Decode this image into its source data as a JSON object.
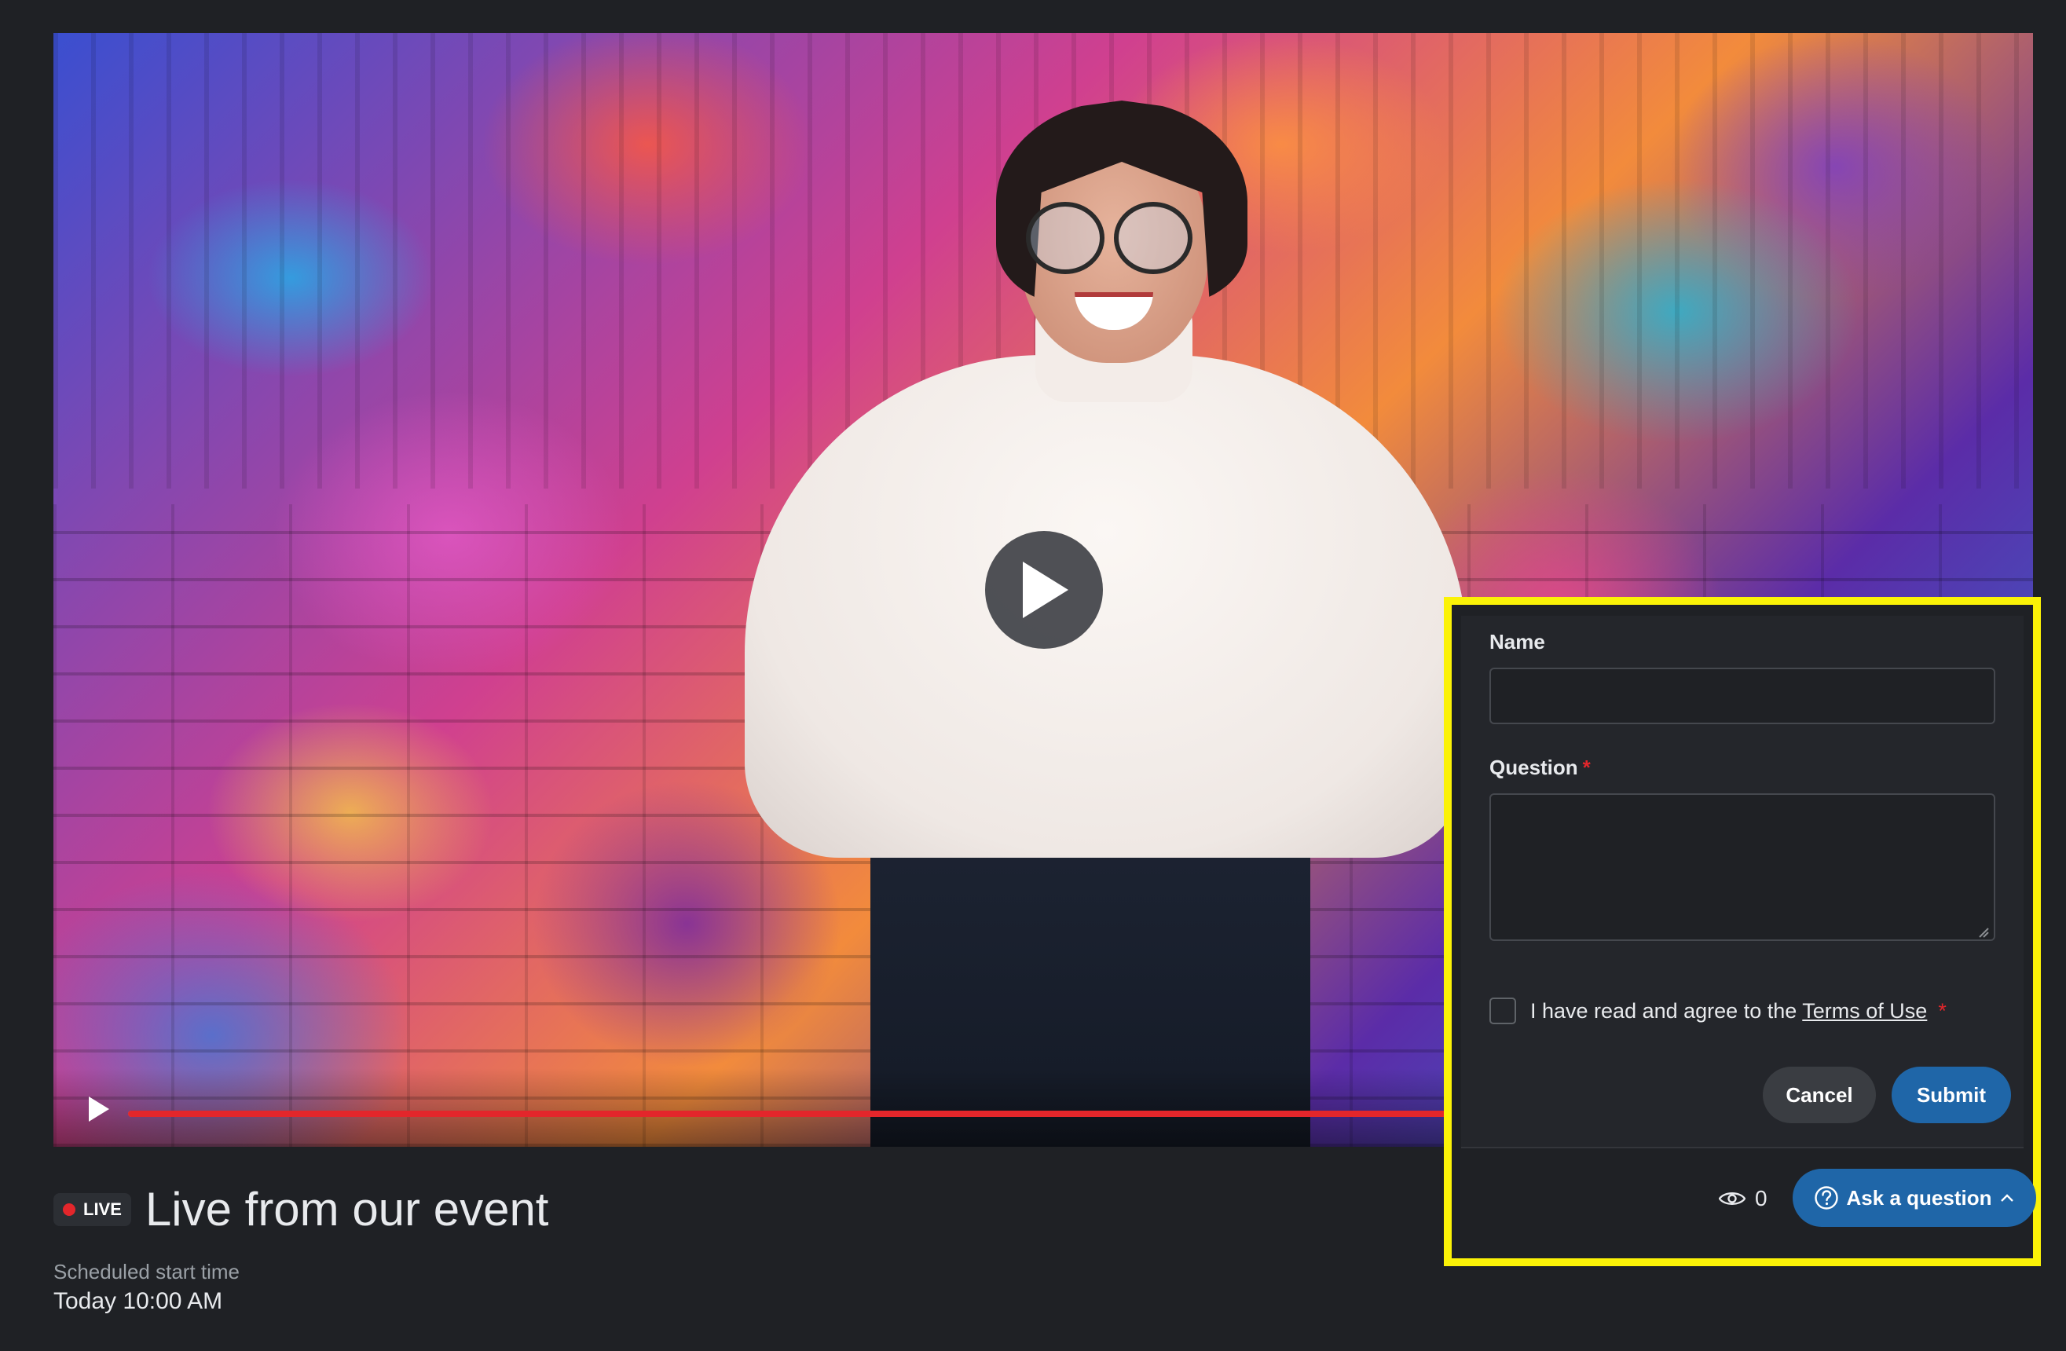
{
  "video": {
    "progress_percent": 100
  },
  "event": {
    "live_badge": "LIVE",
    "title": "Live from our event",
    "schedule_label": "Scheduled start time",
    "schedule_value": "Today 10:00 AM"
  },
  "form": {
    "name_label": "Name",
    "name_value": "",
    "question_label": "Question",
    "question_required": "*",
    "question_value": "",
    "agree_text": "I have read and agree to the ",
    "terms_link": "Terms of Use",
    "agree_required": "*",
    "agree_checked": false,
    "cancel_label": "Cancel",
    "submit_label": "Submit"
  },
  "footer": {
    "viewer_count": "0",
    "ask_label": "Ask a question"
  },
  "colors": {
    "accent": "#1f66a8",
    "live": "#e3262b",
    "highlight": "#fbf207",
    "background": "#1f2125"
  },
  "icons": [
    "play-icon",
    "eye-icon",
    "question-circle-icon",
    "chevron-up-icon"
  ]
}
